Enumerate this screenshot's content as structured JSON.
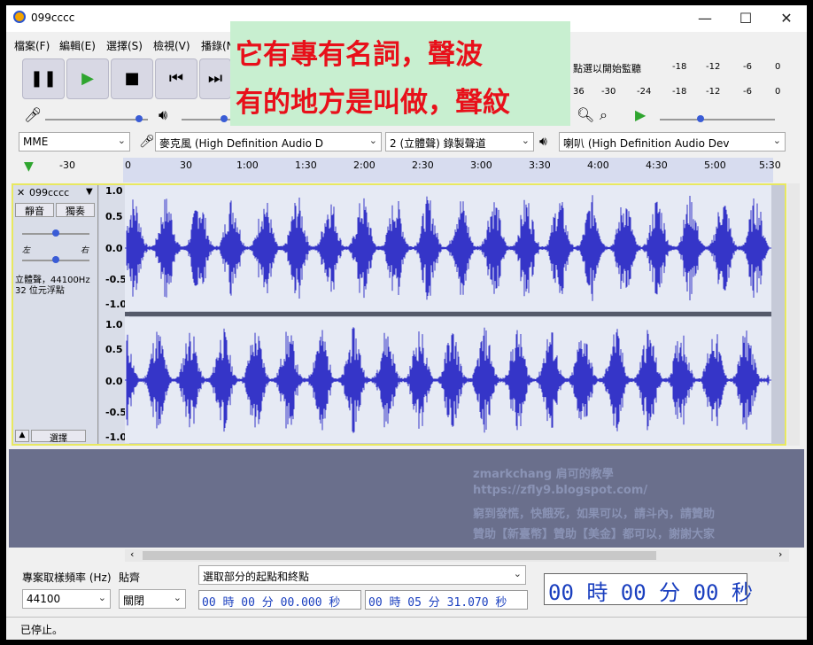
{
  "window": {
    "title": "099cccc",
    "min": "—",
    "max": "☐",
    "close": "✕"
  },
  "menu": [
    "檔案(F)",
    "編輯(E)",
    "選擇(S)",
    "檢視(V)",
    "播錄(N"
  ],
  "overlay": {
    "line1": "它有專有名詞，聲波",
    "line2": "有的地方是叫做，聲紋"
  },
  "meters": {
    "top_label": "點選以開始監聽",
    "scale_top": [
      "-18",
      "-12",
      "-6",
      "0"
    ],
    "scale_bottom": [
      "36",
      "-30",
      "-24",
      "-18",
      "-12",
      "-6",
      "0"
    ]
  },
  "device": {
    "host": "MME",
    "mic": "麥克風 (High Definition Audio D",
    "channels": "2 (立體聲) 錄製聲道",
    "speaker": "喇叭 (High Definition Audio Dev"
  },
  "ruler": [
    "-30",
    "0",
    "30",
    "1:00",
    "1:30",
    "2:00",
    "2:30",
    "3:00",
    "3:30",
    "4:00",
    "4:30",
    "5:00",
    "5:30"
  ],
  "track": {
    "name": "099cccc",
    "mute": "靜音",
    "solo": "獨奏",
    "left": "左",
    "right": "右",
    "info1": "立體聲，44100Hz",
    "info2": "32 位元浮點",
    "select": "選擇",
    "yaxis": [
      "1.0",
      "0.5",
      "0.0",
      "-0.5",
      "-1.0"
    ]
  },
  "watermark": {
    "l1": "zmarkchang 肩可的教學",
    "l2": "https://zfly9.blogspot.com/",
    "l3": "窮到發慌，快餓死，如果可以，請斗內，請贊助",
    "l4": "贊助【新臺幣】贊助【美金】都可以，謝謝大家"
  },
  "bottom": {
    "rate_label": "專案取樣頻率 (Hz)",
    "snap_label": "貼齊",
    "rate_value": "44100",
    "snap_value": "關閉",
    "selection_mode": "選取部分的起點和終點",
    "start_time": "00 時 00 分 00.000 秒",
    "end_time": "00 時 05 分 31.070 秒",
    "big_time": "00 時 00 分 00 秒"
  },
  "status": "已停止。",
  "colors": {
    "waveform": "#3535c8",
    "track_bg": "#e6eaf4",
    "selection_border": "#e8e860"
  }
}
